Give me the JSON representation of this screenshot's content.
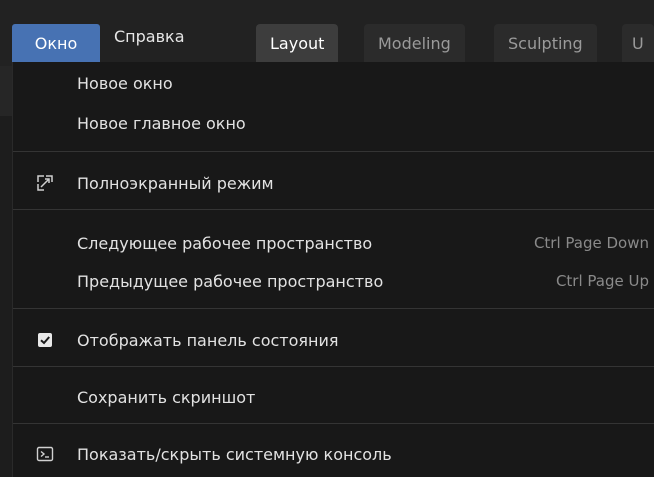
{
  "menubar": {
    "window_menu": "Окно",
    "help_menu": "Справка"
  },
  "workspace_tabs": [
    {
      "label": "Layout",
      "active": true
    },
    {
      "label": "Modeling",
      "active": false
    },
    {
      "label": "Sculpting",
      "active": false
    },
    {
      "label": "U",
      "active": false
    }
  ],
  "window_menu": {
    "items": [
      {
        "label": "Новое окно"
      },
      {
        "label": "Новое главное окно"
      },
      {
        "label": "Полноэкранный режим",
        "icon": "fullscreen-icon"
      },
      {
        "label": "Следующее рабочее пространство",
        "shortcut": "Ctrl Page Down"
      },
      {
        "label": "Предыдущее рабочее пространство",
        "shortcut": "Ctrl Page Up"
      },
      {
        "label": "Отображать панель состояния",
        "icon": "checkbox-checked-icon",
        "checked": true
      },
      {
        "label": "Сохранить скриншот"
      },
      {
        "label": "Показать/скрыть системную консоль",
        "icon": "console-icon"
      }
    ]
  },
  "colors": {
    "accent": "#4772b3",
    "menu_bg": "#181818",
    "separator": "#343434"
  }
}
